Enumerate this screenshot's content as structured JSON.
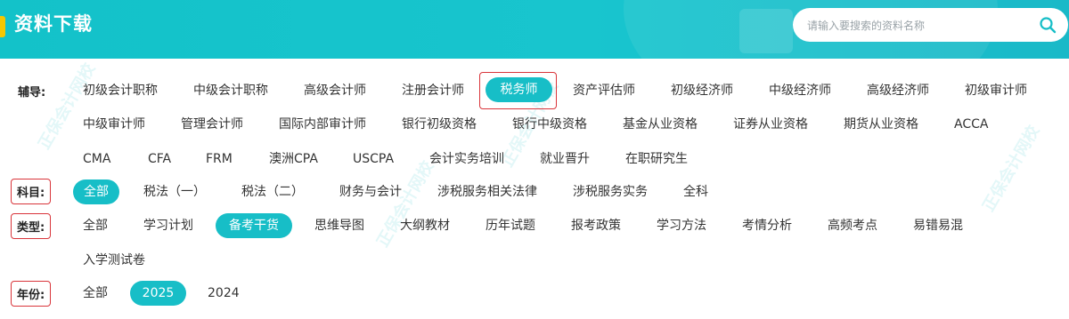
{
  "header": {
    "title": "资料下载",
    "search_placeholder": "请输入要搜索的资料名称"
  },
  "filters": {
    "fudao": {
      "label": "辅导:",
      "row1": [
        "初级会计职称",
        "中级会计职称",
        "高级会计师",
        "注册会计师",
        "税务师",
        "资产评估师",
        "初级经济师",
        "中级经济师",
        "高级经济师",
        "初级审计师"
      ],
      "row2": [
        "中级审计师",
        "管理会计师",
        "国际内部审计师",
        "银行初级资格",
        "银行中级资格",
        "基金从业资格",
        "证券从业资格",
        "期货从业资格",
        "ACCA"
      ],
      "row3": [
        "CMA",
        "CFA",
        "FRM",
        "澳洲CPA",
        "USCPA",
        "会计实务培训",
        "就业晋升",
        "在职研究生"
      ],
      "selected": "税务师"
    },
    "kemu": {
      "label": "科目:",
      "items": [
        "全部",
        "税法（一）",
        "税法（二）",
        "财务与会计",
        "涉税服务相关法律",
        "涉税服务实务",
        "全科"
      ],
      "selected": "全部"
    },
    "leixing": {
      "label": "类型:",
      "row1": [
        "全部",
        "学习计划",
        "备考干货",
        "思维导图",
        "大纲教材",
        "历年试题",
        "报考政策",
        "学习方法",
        "考情分析",
        "高频考点",
        "易错易混"
      ],
      "row2": [
        "入学测试卷"
      ],
      "selected": "备考干货"
    },
    "nianfen": {
      "label": "年份:",
      "items": [
        "全部",
        "2025",
        "2024"
      ],
      "selected": "2025"
    }
  },
  "colors": {
    "accent": "#17bec7",
    "highlight_border": "#d9343a",
    "title_bar": "#f5c700"
  }
}
